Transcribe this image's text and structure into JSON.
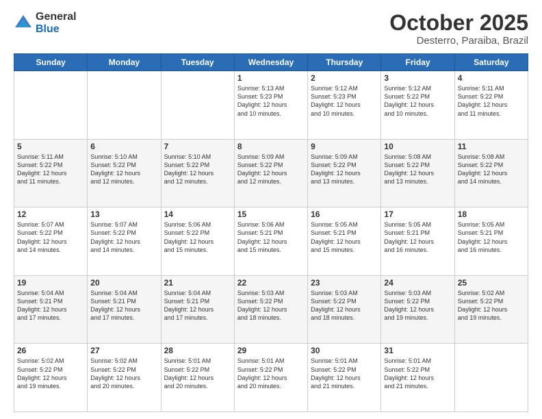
{
  "header": {
    "logo_general": "General",
    "logo_blue": "Blue",
    "month": "October 2025",
    "location": "Desterro, Paraiba, Brazil"
  },
  "days_of_week": [
    "Sunday",
    "Monday",
    "Tuesday",
    "Wednesday",
    "Thursday",
    "Friday",
    "Saturday"
  ],
  "weeks": [
    [
      {
        "day": "",
        "info": ""
      },
      {
        "day": "",
        "info": ""
      },
      {
        "day": "",
        "info": ""
      },
      {
        "day": "1",
        "info": "Sunrise: 5:13 AM\nSunset: 5:23 PM\nDaylight: 12 hours\nand 10 minutes."
      },
      {
        "day": "2",
        "info": "Sunrise: 5:12 AM\nSunset: 5:23 PM\nDaylight: 12 hours\nand 10 minutes."
      },
      {
        "day": "3",
        "info": "Sunrise: 5:12 AM\nSunset: 5:22 PM\nDaylight: 12 hours\nand 10 minutes."
      },
      {
        "day": "4",
        "info": "Sunrise: 5:11 AM\nSunset: 5:22 PM\nDaylight: 12 hours\nand 11 minutes."
      }
    ],
    [
      {
        "day": "5",
        "info": "Sunrise: 5:11 AM\nSunset: 5:22 PM\nDaylight: 12 hours\nand 11 minutes."
      },
      {
        "day": "6",
        "info": "Sunrise: 5:10 AM\nSunset: 5:22 PM\nDaylight: 12 hours\nand 12 minutes."
      },
      {
        "day": "7",
        "info": "Sunrise: 5:10 AM\nSunset: 5:22 PM\nDaylight: 12 hours\nand 12 minutes."
      },
      {
        "day": "8",
        "info": "Sunrise: 5:09 AM\nSunset: 5:22 PM\nDaylight: 12 hours\nand 12 minutes."
      },
      {
        "day": "9",
        "info": "Sunrise: 5:09 AM\nSunset: 5:22 PM\nDaylight: 12 hours\nand 13 minutes."
      },
      {
        "day": "10",
        "info": "Sunrise: 5:08 AM\nSunset: 5:22 PM\nDaylight: 12 hours\nand 13 minutes."
      },
      {
        "day": "11",
        "info": "Sunrise: 5:08 AM\nSunset: 5:22 PM\nDaylight: 12 hours\nand 14 minutes."
      }
    ],
    [
      {
        "day": "12",
        "info": "Sunrise: 5:07 AM\nSunset: 5:22 PM\nDaylight: 12 hours\nand 14 minutes."
      },
      {
        "day": "13",
        "info": "Sunrise: 5:07 AM\nSunset: 5:22 PM\nDaylight: 12 hours\nand 14 minutes."
      },
      {
        "day": "14",
        "info": "Sunrise: 5:06 AM\nSunset: 5:22 PM\nDaylight: 12 hours\nand 15 minutes."
      },
      {
        "day": "15",
        "info": "Sunrise: 5:06 AM\nSunset: 5:21 PM\nDaylight: 12 hours\nand 15 minutes."
      },
      {
        "day": "16",
        "info": "Sunrise: 5:05 AM\nSunset: 5:21 PM\nDaylight: 12 hours\nand 15 minutes."
      },
      {
        "day": "17",
        "info": "Sunrise: 5:05 AM\nSunset: 5:21 PM\nDaylight: 12 hours\nand 16 minutes."
      },
      {
        "day": "18",
        "info": "Sunrise: 5:05 AM\nSunset: 5:21 PM\nDaylight: 12 hours\nand 16 minutes."
      }
    ],
    [
      {
        "day": "19",
        "info": "Sunrise: 5:04 AM\nSunset: 5:21 PM\nDaylight: 12 hours\nand 17 minutes."
      },
      {
        "day": "20",
        "info": "Sunrise: 5:04 AM\nSunset: 5:21 PM\nDaylight: 12 hours\nand 17 minutes."
      },
      {
        "day": "21",
        "info": "Sunrise: 5:04 AM\nSunset: 5:21 PM\nDaylight: 12 hours\nand 17 minutes."
      },
      {
        "day": "22",
        "info": "Sunrise: 5:03 AM\nSunset: 5:22 PM\nDaylight: 12 hours\nand 18 minutes."
      },
      {
        "day": "23",
        "info": "Sunrise: 5:03 AM\nSunset: 5:22 PM\nDaylight: 12 hours\nand 18 minutes."
      },
      {
        "day": "24",
        "info": "Sunrise: 5:03 AM\nSunset: 5:22 PM\nDaylight: 12 hours\nand 19 minutes."
      },
      {
        "day": "25",
        "info": "Sunrise: 5:02 AM\nSunset: 5:22 PM\nDaylight: 12 hours\nand 19 minutes."
      }
    ],
    [
      {
        "day": "26",
        "info": "Sunrise: 5:02 AM\nSunset: 5:22 PM\nDaylight: 12 hours\nand 19 minutes."
      },
      {
        "day": "27",
        "info": "Sunrise: 5:02 AM\nSunset: 5:22 PM\nDaylight: 12 hours\nand 20 minutes."
      },
      {
        "day": "28",
        "info": "Sunrise: 5:01 AM\nSunset: 5:22 PM\nDaylight: 12 hours\nand 20 minutes."
      },
      {
        "day": "29",
        "info": "Sunrise: 5:01 AM\nSunset: 5:22 PM\nDaylight: 12 hours\nand 20 minutes."
      },
      {
        "day": "30",
        "info": "Sunrise: 5:01 AM\nSunset: 5:22 PM\nDaylight: 12 hours\nand 21 minutes."
      },
      {
        "day": "31",
        "info": "Sunrise: 5:01 AM\nSunset: 5:22 PM\nDaylight: 12 hours\nand 21 minutes."
      },
      {
        "day": "",
        "info": ""
      }
    ]
  ]
}
